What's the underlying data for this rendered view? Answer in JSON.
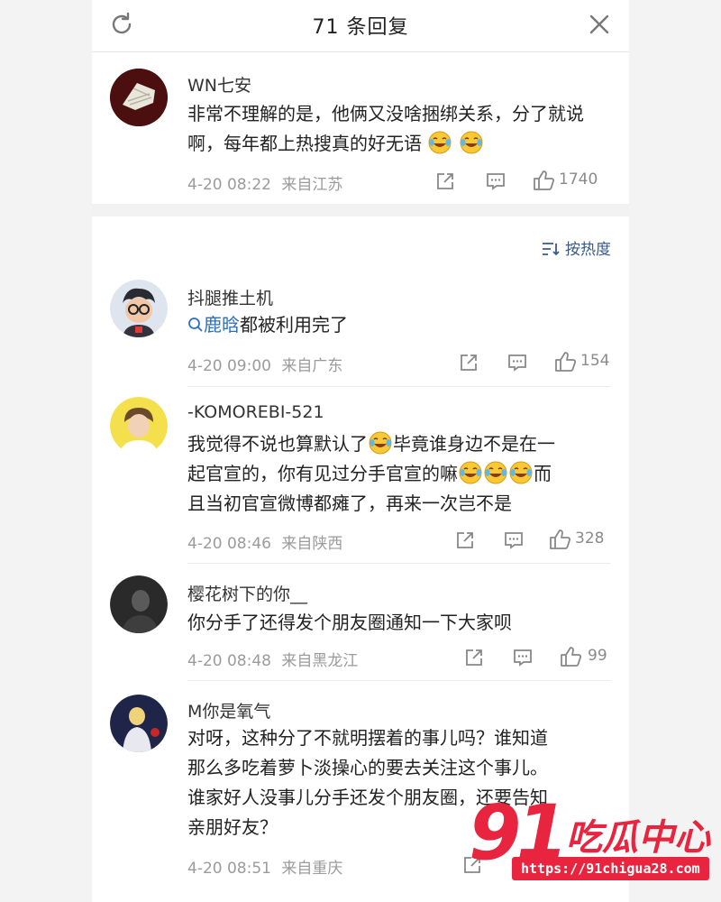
{
  "header": {
    "title": "71 条回复",
    "refresh_icon": "refresh-icon",
    "close_icon": "close-icon"
  },
  "sort": {
    "label": "按热度",
    "icon": "sort-icon"
  },
  "root_comment": {
    "user": "WN七安",
    "text": "非常不理解的是，他俩又没啥捆绑关系，分了就说啊，每年都上热搜真的好无语",
    "time": "4-20 08:22",
    "location": "来自江苏",
    "likes": "1740"
  },
  "replies": [
    {
      "user": "抖腿推土机",
      "topic": "鹿晗",
      "text": "都被利用完了",
      "time": "4-20 09:00",
      "location": "来自广东",
      "likes": "154"
    },
    {
      "user": "-KOMOREBI-521",
      "text_line1a": "我觉得不说也算默认了",
      "text_line1b": "毕竟谁身边不是在一",
      "text_line2a": "起官宣的，你有见过分手官宣的嘛",
      "text_line2b": "而",
      "text_line3": "且当初官宣微博都瘫了，再来一次岂不是",
      "time": "4-20 08:46",
      "location": "来自陕西",
      "likes": "328"
    },
    {
      "user": "樱花树下的你__",
      "text": "你分手了还得发个朋友圈通知一下大家呗",
      "time": "4-20 08:48",
      "location": "来自黑龙江",
      "likes": "99"
    },
    {
      "user": "M你是氧气",
      "text_line1": "对呀，这种分了不就明摆着的事儿吗？谁知道",
      "text_line2": "那么多吃着萝卜淡操心的要去关注这个事儿。",
      "text_line3": "谁家好人没事儿分手还发个朋友圈，还要告知",
      "text_line4": "亲朋好友？",
      "time": "4-20 08:51",
      "location": "来自重庆"
    }
  ],
  "watermark": {
    "number": "91",
    "brand": "吃瓜中心",
    "url": "https://91chigua28.com"
  },
  "colors": {
    "accent_link": "#2f6fc0",
    "watermark_red": "#e8243e",
    "meta_gray": "#9b9b9b"
  }
}
